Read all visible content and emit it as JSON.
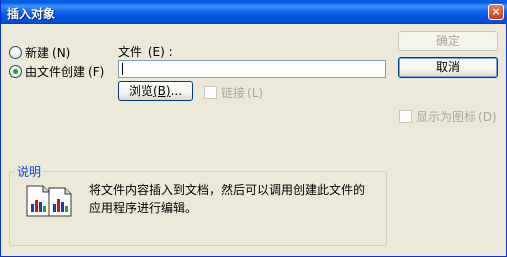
{
  "window": {
    "title": "插入对象",
    "close_glyph": "×"
  },
  "options": {
    "new_label": "新建",
    "new_key": "(N)",
    "from_file_label": "由文件创建",
    "from_file_key": "(F)"
  },
  "file": {
    "label": "文件",
    "key": "(E)",
    "colon": ":",
    "value": ""
  },
  "buttons": {
    "ok": "确定",
    "cancel": "取消",
    "browse": "浏览",
    "browse_key": "(B)",
    "browse_suffix": "..."
  },
  "checkboxes": {
    "link_label": "链接",
    "link_key": "(L)",
    "display_icon_label": "显示为图标",
    "display_icon_key": "(D)"
  },
  "description": {
    "title": "说明",
    "text": "将文件内容插入到文档，然后可以调用创建此文件的应用程序进行编辑。"
  },
  "icons": {
    "close": "close-icon",
    "result": "document-with-chart-icon"
  }
}
